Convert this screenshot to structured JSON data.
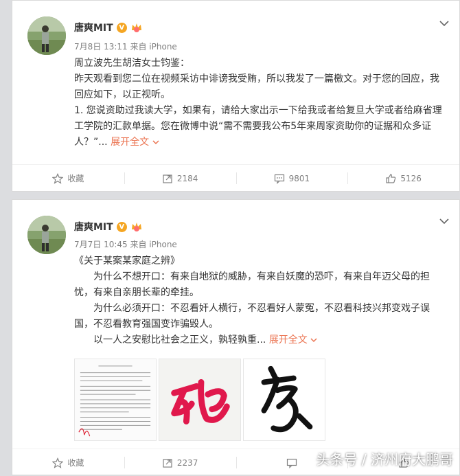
{
  "posts": [
    {
      "author": "唐爽MIT",
      "meta": "7月8日 13:11 来自 iPhone",
      "paragraphs": [
        "周立波先生胡洁女士钧鉴：",
        "昨天观看到您二位在视频采访中诽谤我受贿，所以我发了一篇檄文。对于您的回应，我回应如下，以正视听。",
        "1. 您说资助过我读大学，如果有，请给大家出示一下给我或者给复旦大学或者给麻省理工学院的汇款单据。您在微博中说“需不需要我公布5年来周家资助你的证据和众多证人？”"
      ],
      "ellipsis": "...",
      "expand": "展开全文",
      "actions": {
        "favorite": "收藏",
        "repost": "2184",
        "comment": "9801",
        "like": "5126"
      }
    },
    {
      "author": "唐爽MIT",
      "meta": "7月7日 10:45 来自 iPhone",
      "paragraphs": [
        "《关于某案某家庭之辨》",
        "为什么不想开口：有来自地狱的威胁，有来自妖魔的恐吓，有来自年迈父母的担忧，有来自亲朋长辈的牵挂。",
        "为什么必须开口：不忍看奸人横行，不忍看好人蒙冤，不忍看科技兴邦变戏子误国，不忍看教育强国变诈骗毁人。",
        "以一人之安慰比社会之正义，孰轻孰重"
      ],
      "ellipsis": "...",
      "expand": "展开全文",
      "images": [
        "document-thumbnail",
        "red-calligraphy-thumbnail",
        "black-calligraphy-thumbnail"
      ],
      "actions": {
        "favorite": "收藏",
        "repost": "2237"
      }
    }
  ],
  "watermark": "头条号 / 济州府大鹏哥",
  "colors": {
    "expand": "#eb7350",
    "badge": "#f5a623",
    "background": "#dcdde0"
  }
}
